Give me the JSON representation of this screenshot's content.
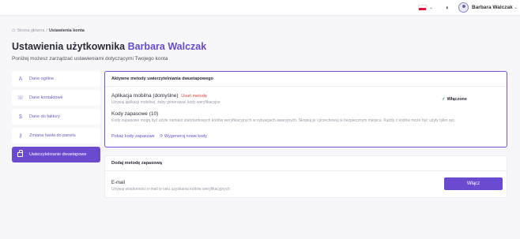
{
  "topbar": {
    "language_chevron": "⌄",
    "theme_icon": "◐",
    "user_name": "Barbara Walczak",
    "user_chevron": "⌄"
  },
  "breadcrumb": {
    "home": "Strona główna",
    "separator": "/",
    "current": "Ustawienia konta"
  },
  "page": {
    "title_prefix": "Ustawienia użytkownika",
    "title_name": "Barbara Walczak",
    "subtitle": "Poniżej możesz zarządzać ustawieniami dotyczącymi Twojego konta"
  },
  "sidebar": {
    "items": [
      {
        "label": "Dane ogólne",
        "icon": "user-icon"
      },
      {
        "label": "Dane kontaktowe",
        "icon": "phone-icon"
      },
      {
        "label": "Dane do faktury",
        "icon": "dollar-icon"
      },
      {
        "label": "Zmiana hasła do panelu",
        "icon": "key-icon"
      },
      {
        "label": "Uwierzytelnianie dwuetapowe",
        "icon": "lock-icon",
        "active": true
      }
    ]
  },
  "active_methods": {
    "header": "Aktywne metody uwierzytelniania dwuetapowego",
    "mobile": {
      "title": "Aplikacja mobilna (domyślne)",
      "remove_label": "Usuń metodę",
      "description": "Używaj aplikacji mobilnej, żeby generować kody weryfikacyjne",
      "status": "Włączone"
    },
    "backup": {
      "title": "Kody zapasowe (10)",
      "description": "Kody zapasowe mogą być użyte zamiast standardowych kodów weryfikacyjnych w sytuacjach awaryjnych. Skopiuj je i przechowuj w bezpiecznym miejscu. Każdy z kodów może być użyty tylko raz.",
      "show_label": "Pokaż kody zapasowe",
      "regenerate_label": "Wygeneruj nowe kody"
    }
  },
  "add_method": {
    "header": "Dodaj metodę zapasową",
    "email_title": "E-mail",
    "email_description": "Używaj wiadomości e-mail w celu uzyskania kodów weryfikacyjnych",
    "enable_label": "Włącz"
  },
  "colors": {
    "accent": "#6a4bd0",
    "danger": "#e0443a",
    "success": "#3a9a5a"
  }
}
